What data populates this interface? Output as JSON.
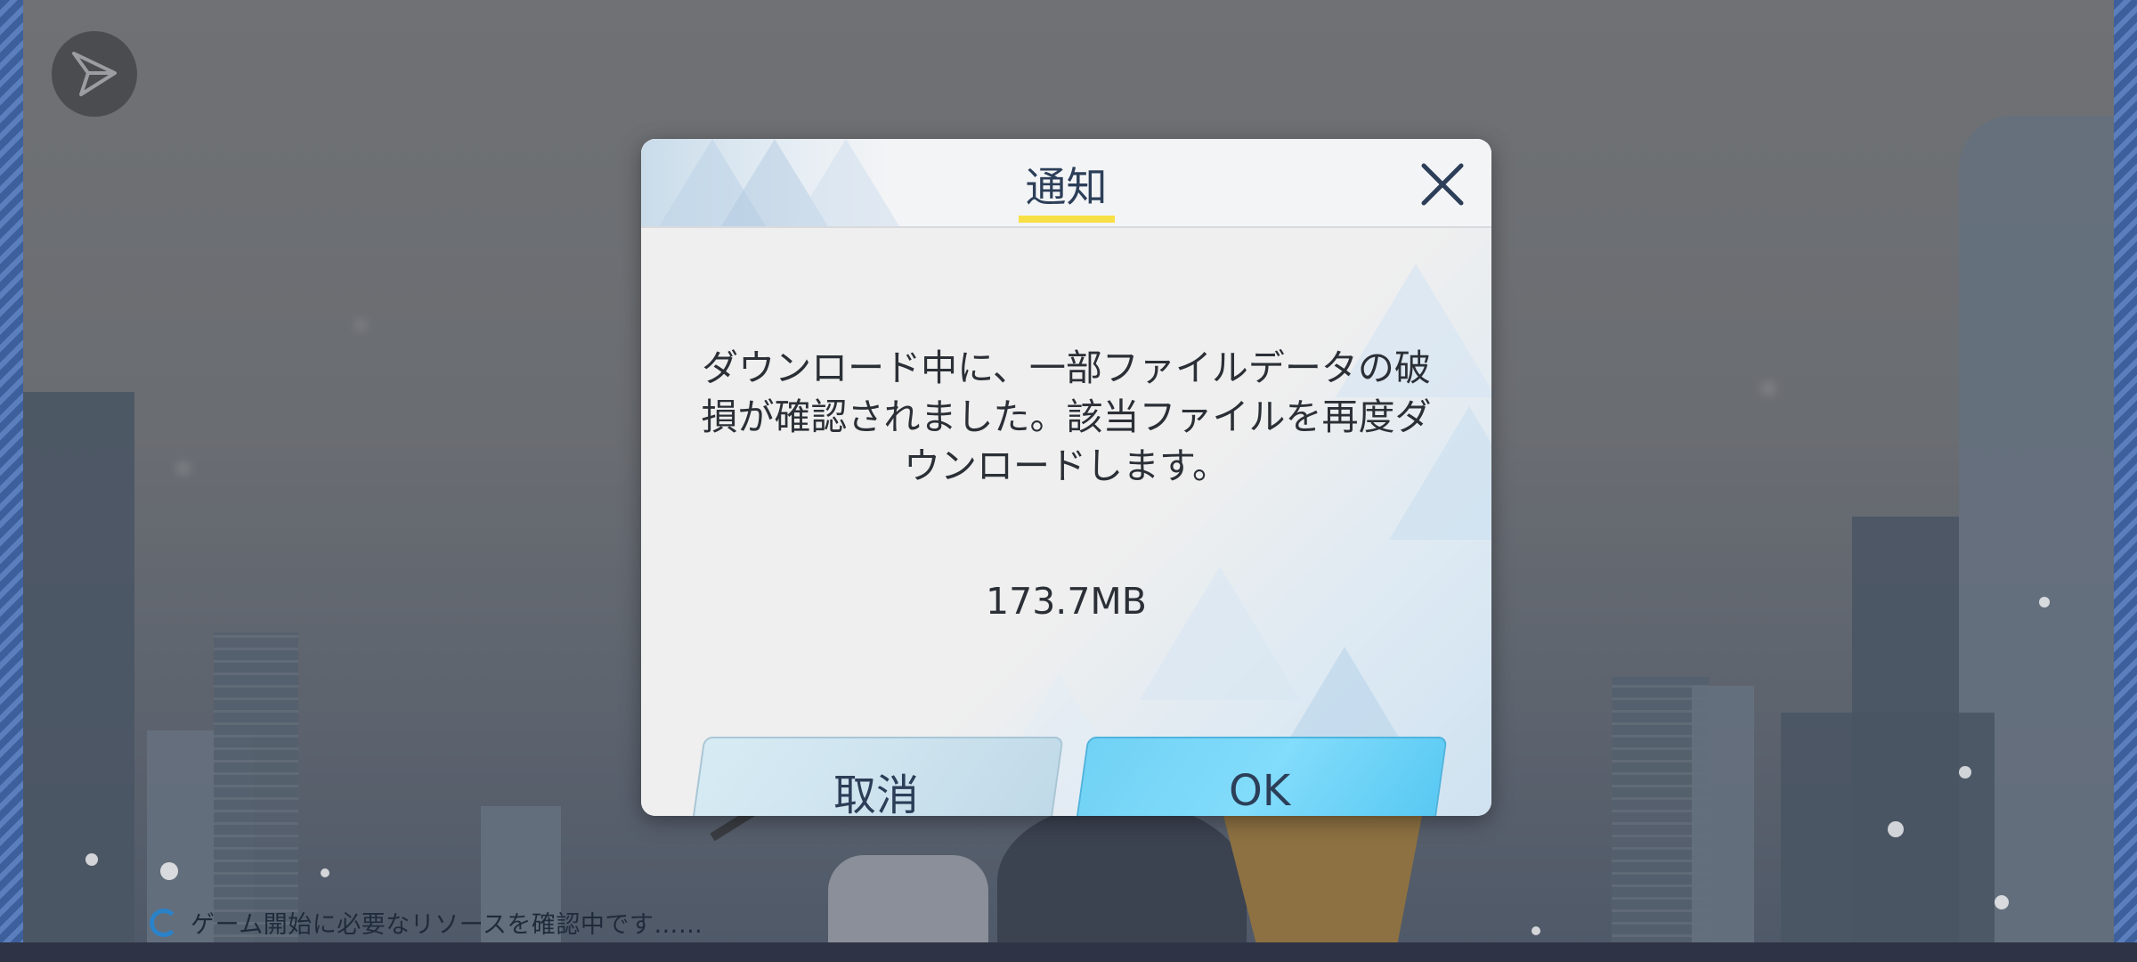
{
  "background": {
    "share_icon": "send-arrow-icon"
  },
  "dialog": {
    "title": "通知",
    "close_icon": "close-icon",
    "message": "ダウンロード中に、一部ファイルデータの破損が確認されました。該当ファイルを再度ダウンロードします。",
    "size": "173.7MB",
    "cancel_label": "取消",
    "ok_label": "OK"
  },
  "status": {
    "loading_icon": "loading-spinner-icon",
    "text": "ゲーム開始に必要なリソースを確認中です……"
  },
  "colors": {
    "ok_button": "#71d2f5",
    "cancel_button": "#d7ebf4",
    "title_underline": "#f7e046",
    "stripe": "#3d5f9c"
  }
}
